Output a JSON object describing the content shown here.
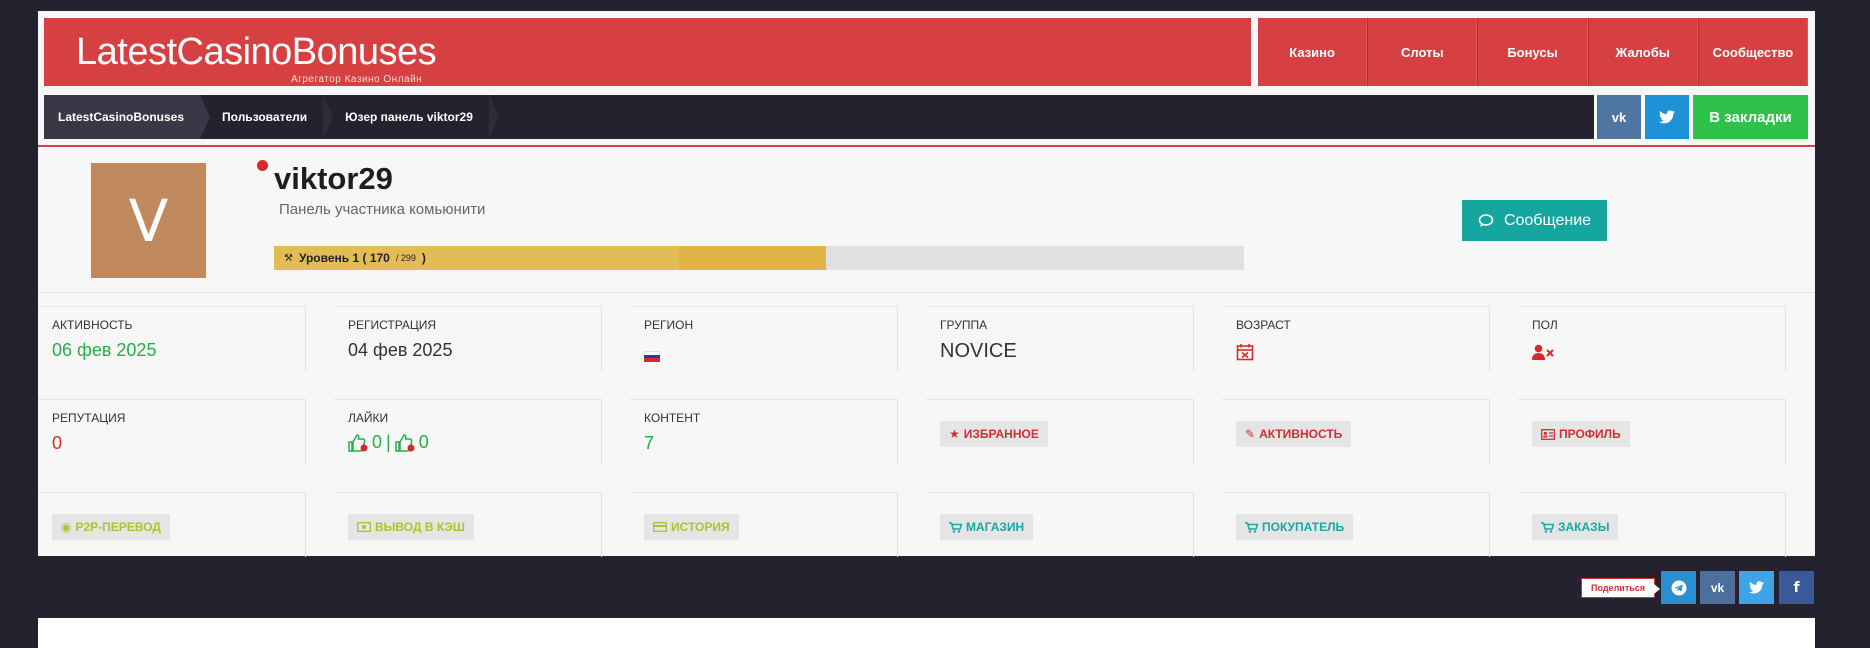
{
  "header": {
    "logo_title": "LatestCasinoBonuses",
    "logo_subtitle": "Агрегатор Казино Онлайн",
    "nav": [
      "Казино",
      "Слоты",
      "Бонусы",
      "Жалобы",
      "Сообщество"
    ]
  },
  "breadcrumb": [
    "LatestCasinoBonuses",
    "Пользователи",
    "Юзер панель viktor29"
  ],
  "social": {
    "vk": "vk",
    "twitter": "tw",
    "bookmark": "В закладки"
  },
  "profile": {
    "avatar_letter": "V",
    "username": "viktor29",
    "subtitle": "Панель участника комьюнити",
    "level_label": "Уровень 1 ( 170",
    "level_max": "/ 299",
    "level_close": ")",
    "level_progress": 0.5686,
    "message_button": "Сообщение"
  },
  "stats": {
    "activity_label": "АКТИВНОСТЬ",
    "activity_value": "06 фев 2025",
    "registration_label": "РЕГИСТРАЦИЯ",
    "registration_value": "04 фев 2025",
    "region_label": "РЕГИОН",
    "group_label": "ГРУППА",
    "group_value": "NOVICE",
    "age_label": "ВОЗРАСТ",
    "gender_label": "ПОЛ",
    "reputation_label": "РЕПУТАЦИЯ",
    "reputation_value": "0",
    "likes_label": "ЛАЙКИ",
    "likes_up": "0",
    "likes_sep": "|",
    "likes_down": "0",
    "content_label": "КОНТЕНТ",
    "content_value": "7"
  },
  "actions": {
    "favorites": "ИЗБРАННОЕ",
    "activity": "АКТИВНОСТЬ",
    "profile": "ПРОФИЛЬ",
    "p2p": "P2P-ПЕРЕВОД",
    "cashout": "ВЫВОД В КЭШ",
    "history": "ИСТОРИЯ",
    "shop": "МАГАЗИН",
    "buyer": "ПОКУПАТЕЛЬ",
    "orders": "ЗАКАЗЫ"
  },
  "share": {
    "label": "Поделиться"
  },
  "colors": {
    "brand_red": "#d74043",
    "dark_bg": "#24222f",
    "teal": "#15a6a0",
    "green": "#2aac48",
    "level_gold": "#e1b545"
  }
}
